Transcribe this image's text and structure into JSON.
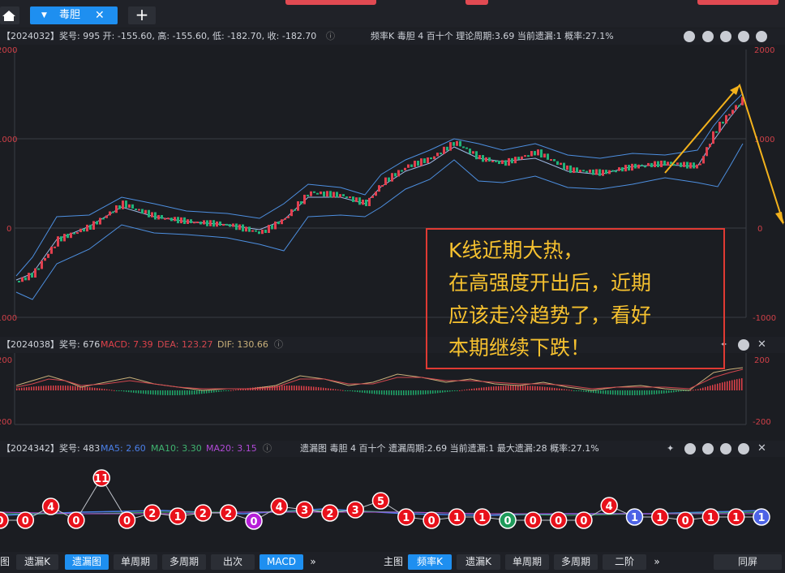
{
  "tabs": {
    "active_label": "毒胆",
    "close_glyph": "✕",
    "add_glyph": "+"
  },
  "kline": {
    "info": "【2024032】奖号: 995  开: -155.60, 高: -155.60, 低: -182.70, 收: -182.70",
    "right_info": "频率K  毒胆  4  百十个  理论周期:3.69  当前遗漏:1  概率:27.1%",
    "axis_left": [
      "2000",
      "1000",
      "0",
      "-1000"
    ],
    "axis_right": [
      "2000",
      "1000",
      "0",
      "-1000"
    ]
  },
  "macd": {
    "info_prefix": "【2024038】奖号: 676",
    "macd_label": "MACD: 7.39",
    "dea_label": "DEA: 123.27",
    "dif_label": "DIF: 130.66",
    "axis_left": [
      "200",
      "-200"
    ],
    "axis_right": [
      "200",
      "-200"
    ],
    "colors": {
      "macd": "#e0414a",
      "dea": "#d2474f",
      "dif": "#c9b07a"
    }
  },
  "miss": {
    "info_prefix": "【2024342】奖号: 483",
    "ma5": "MA5: 2.60",
    "ma10": "MA10: 3.30",
    "ma20": "MA20: 3.15",
    "right_info": "遗漏图  毒胆  4  百十个  遗漏周期:2.69  当前遗漏:1  最大遗漏:28  概率:27.1%",
    "colors": {
      "ma5": "#4a7fe8",
      "ma10": "#3fb36f",
      "ma20": "#b04ad6"
    },
    "bubbles": [
      {
        "v": "0",
        "c": "#e8111b"
      },
      {
        "v": "0",
        "c": "#e8111b"
      },
      {
        "v": "4",
        "c": "#e8111b"
      },
      {
        "v": "0",
        "c": "#e8111b"
      },
      {
        "v": "11",
        "c": "#e8111b"
      },
      {
        "v": "0",
        "c": "#e8111b"
      },
      {
        "v": "2",
        "c": "#e8111b"
      },
      {
        "v": "1",
        "c": "#e8111b"
      },
      {
        "v": "2",
        "c": "#e8111b"
      },
      {
        "v": "2",
        "c": "#e8111b"
      },
      {
        "v": "0",
        "c": "#b61fd8"
      },
      {
        "v": "4",
        "c": "#e8111b"
      },
      {
        "v": "3",
        "c": "#e8111b"
      },
      {
        "v": "2",
        "c": "#e8111b"
      },
      {
        "v": "3",
        "c": "#e8111b"
      },
      {
        "v": "5",
        "c": "#e8111b"
      },
      {
        "v": "1",
        "c": "#e8111b"
      },
      {
        "v": "0",
        "c": "#e8111b"
      },
      {
        "v": "1",
        "c": "#e8111b"
      },
      {
        "v": "1",
        "c": "#e8111b"
      },
      {
        "v": "0",
        "c": "#1e9a5a"
      },
      {
        "v": "0",
        "c": "#e8111b"
      },
      {
        "v": "0",
        "c": "#e8111b"
      },
      {
        "v": "0",
        "c": "#e8111b"
      },
      {
        "v": "4",
        "c": "#e8111b"
      },
      {
        "v": "1",
        "c": "#4d63e6"
      },
      {
        "v": "1",
        "c": "#e8111b"
      },
      {
        "v": "0",
        "c": "#e8111b"
      },
      {
        "v": "1",
        "c": "#e8111b"
      },
      {
        "v": "1",
        "c": "#e8111b"
      },
      {
        "v": "1",
        "c": "#4d63e6"
      }
    ]
  },
  "annotation": {
    "lines": [
      "K线近期大热，",
      "在高强度开出后，近期",
      "应该走冷趋势了，看好",
      "本期继续下跌！"
    ],
    "box_color": "#e03a33",
    "text_color": "#f6c12f"
  },
  "bottom": {
    "left_tabs": [
      "图",
      "遗漏K",
      "遗漏图",
      "单周期",
      "多周期",
      "出次",
      "MACD"
    ],
    "left_active": "遗漏图",
    "right_tabs": [
      "主图",
      "频率K",
      "遗漏K",
      "单周期",
      "多周期",
      "二阶"
    ],
    "right_active": "频率K",
    "more_glyph": "»",
    "fullscreen": "同屏"
  },
  "icons": [
    "home-icon",
    "close-icon",
    "plus-icon",
    "pencil-icon",
    "back-icon",
    "up-icon",
    "down-icon",
    "settings-icon",
    "help-icon",
    "pin-icon",
    "close-icon"
  ]
}
